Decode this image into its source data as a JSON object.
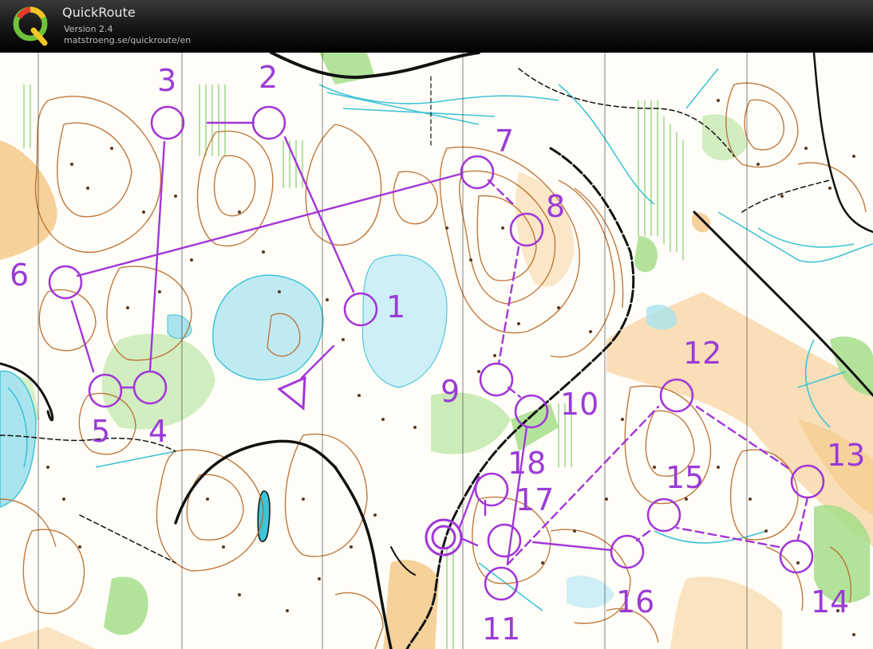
{
  "app": {
    "name": "QuickRoute",
    "version": "Version 2.4",
    "url": "matstroeng.se/quickroute/en",
    "logo_letter": "Q"
  },
  "colors": {
    "course": "#a236d8",
    "contour": "#b86a2a",
    "open_land": "#f6c987",
    "green": "#a7df8c",
    "water": "#3fc3d7",
    "water_fill": "#a9e4ee",
    "track": "#111111"
  },
  "course": {
    "start_label": "start-triangle",
    "controls": [
      {
        "id": "1",
        "label": "1"
      },
      {
        "id": "2",
        "label": "2"
      },
      {
        "id": "3",
        "label": "3"
      },
      {
        "id": "4",
        "label": "4"
      },
      {
        "id": "5",
        "label": "5"
      },
      {
        "id": "6",
        "label": "6"
      },
      {
        "id": "7",
        "label": "7"
      },
      {
        "id": "8",
        "label": "8"
      },
      {
        "id": "9",
        "label": "9"
      },
      {
        "id": "10",
        "label": "10"
      },
      {
        "id": "11",
        "label": "11"
      },
      {
        "id": "12",
        "label": "12"
      },
      {
        "id": "13",
        "label": "13"
      },
      {
        "id": "14",
        "label": "14"
      },
      {
        "id": "15",
        "label": "15"
      },
      {
        "id": "16",
        "label": "16"
      },
      {
        "id": "17",
        "label": "17"
      },
      {
        "id": "18",
        "label": "18"
      }
    ]
  }
}
